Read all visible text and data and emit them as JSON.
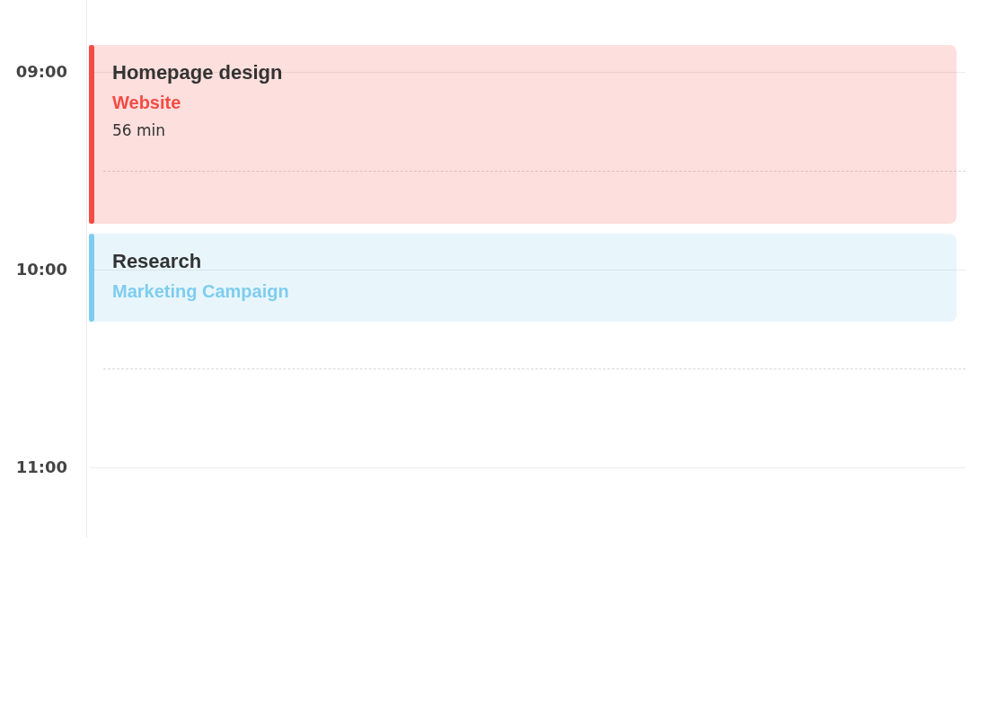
{
  "timeline": {
    "hours": [
      {
        "label": "09:00"
      },
      {
        "label": "10:00"
      },
      {
        "label": "11:00"
      }
    ]
  },
  "events": [
    {
      "title": "Homepage design",
      "project": "Website",
      "duration": "56 min",
      "color": "#f44b45"
    },
    {
      "title": "Research",
      "project": "Marketing Campaign",
      "color": "#7fcdee"
    }
  ]
}
